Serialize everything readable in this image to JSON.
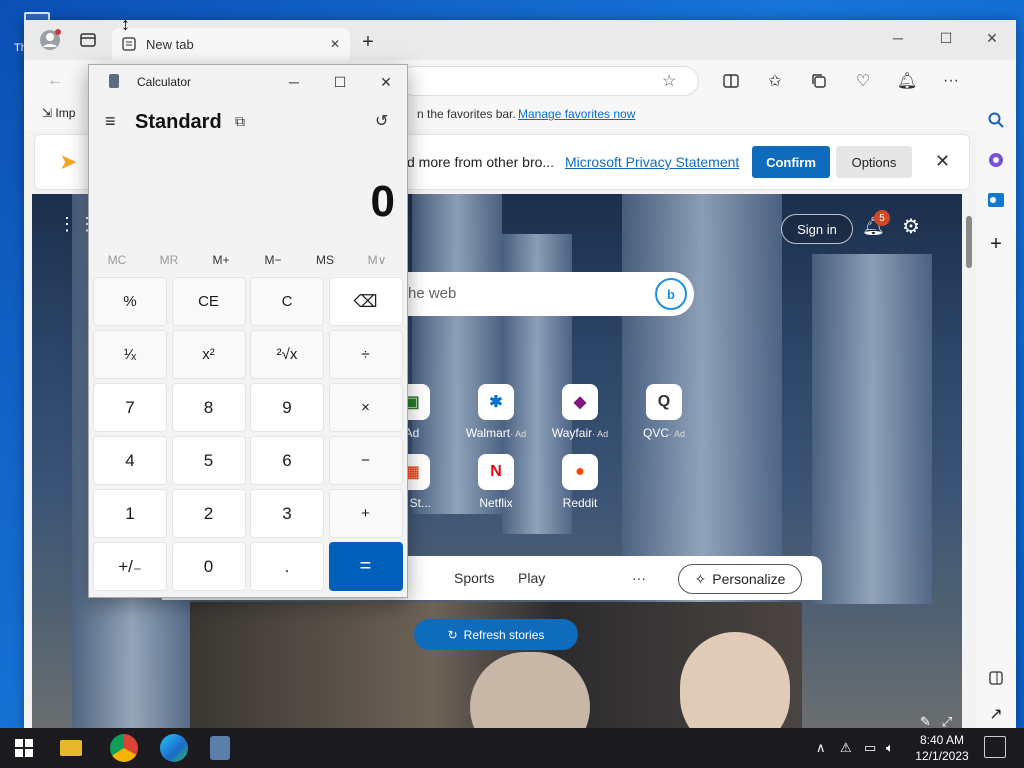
{
  "desktop": {
    "icon_label": "Th"
  },
  "browser": {
    "tab_title": "New tab",
    "new_tab_symbol": "+",
    "favbar_text": "n the favorites bar.",
    "favbar_link": "Manage favorites now",
    "favbar_import": "Imp",
    "banner_text": "d more from other bro...",
    "banner_link": "Microsoft Privacy Statement",
    "confirm_label": "Confirm",
    "options_label": "Options",
    "close_symbol": "✕"
  },
  "newtab": {
    "signin_label": "Sign in",
    "notification_count": "5",
    "search_placeholder": "he web",
    "bing_label": "b",
    "tiles": [
      {
        "label": "Ad",
        "ad": ""
      },
      {
        "label": "Walmart",
        "ad": "· Ad"
      },
      {
        "label": "Wayfair",
        "ad": "· Ad"
      },
      {
        "label": "QVC",
        "ad": "· Ad"
      },
      {
        "label": "oft St...",
        "ad": ""
      },
      {
        "label": "Netflix",
        "ad": ""
      },
      {
        "label": "Reddit",
        "ad": ""
      }
    ],
    "feed_items": [
      "Sports",
      "Play",
      "···"
    ],
    "personalize_label": "Personalize",
    "refresh_label": "Refresh stories"
  },
  "calculator": {
    "app_title": "Calculator",
    "mode": "Standard",
    "display_value": "0",
    "memory": [
      "MC",
      "MR",
      "M+",
      "M−",
      "MS",
      "M∨"
    ],
    "keys": [
      [
        "%",
        "CE",
        "C",
        "⌫"
      ],
      [
        "¹⁄ₓ",
        "x²",
        "²√x",
        "÷"
      ],
      [
        "7",
        "8",
        "9",
        "×"
      ],
      [
        "4",
        "5",
        "6",
        "−"
      ],
      [
        "1",
        "2",
        "3",
        "+"
      ],
      [
        "+/₋",
        "0",
        ".",
        "="
      ]
    ]
  },
  "taskbar": {
    "time": "8:40 AM",
    "date": "12/1/2023"
  },
  "colors": {
    "accent": "#0f6cbd",
    "calc_equals": "#005fb8",
    "taskbar": "#1b1b1f"
  }
}
